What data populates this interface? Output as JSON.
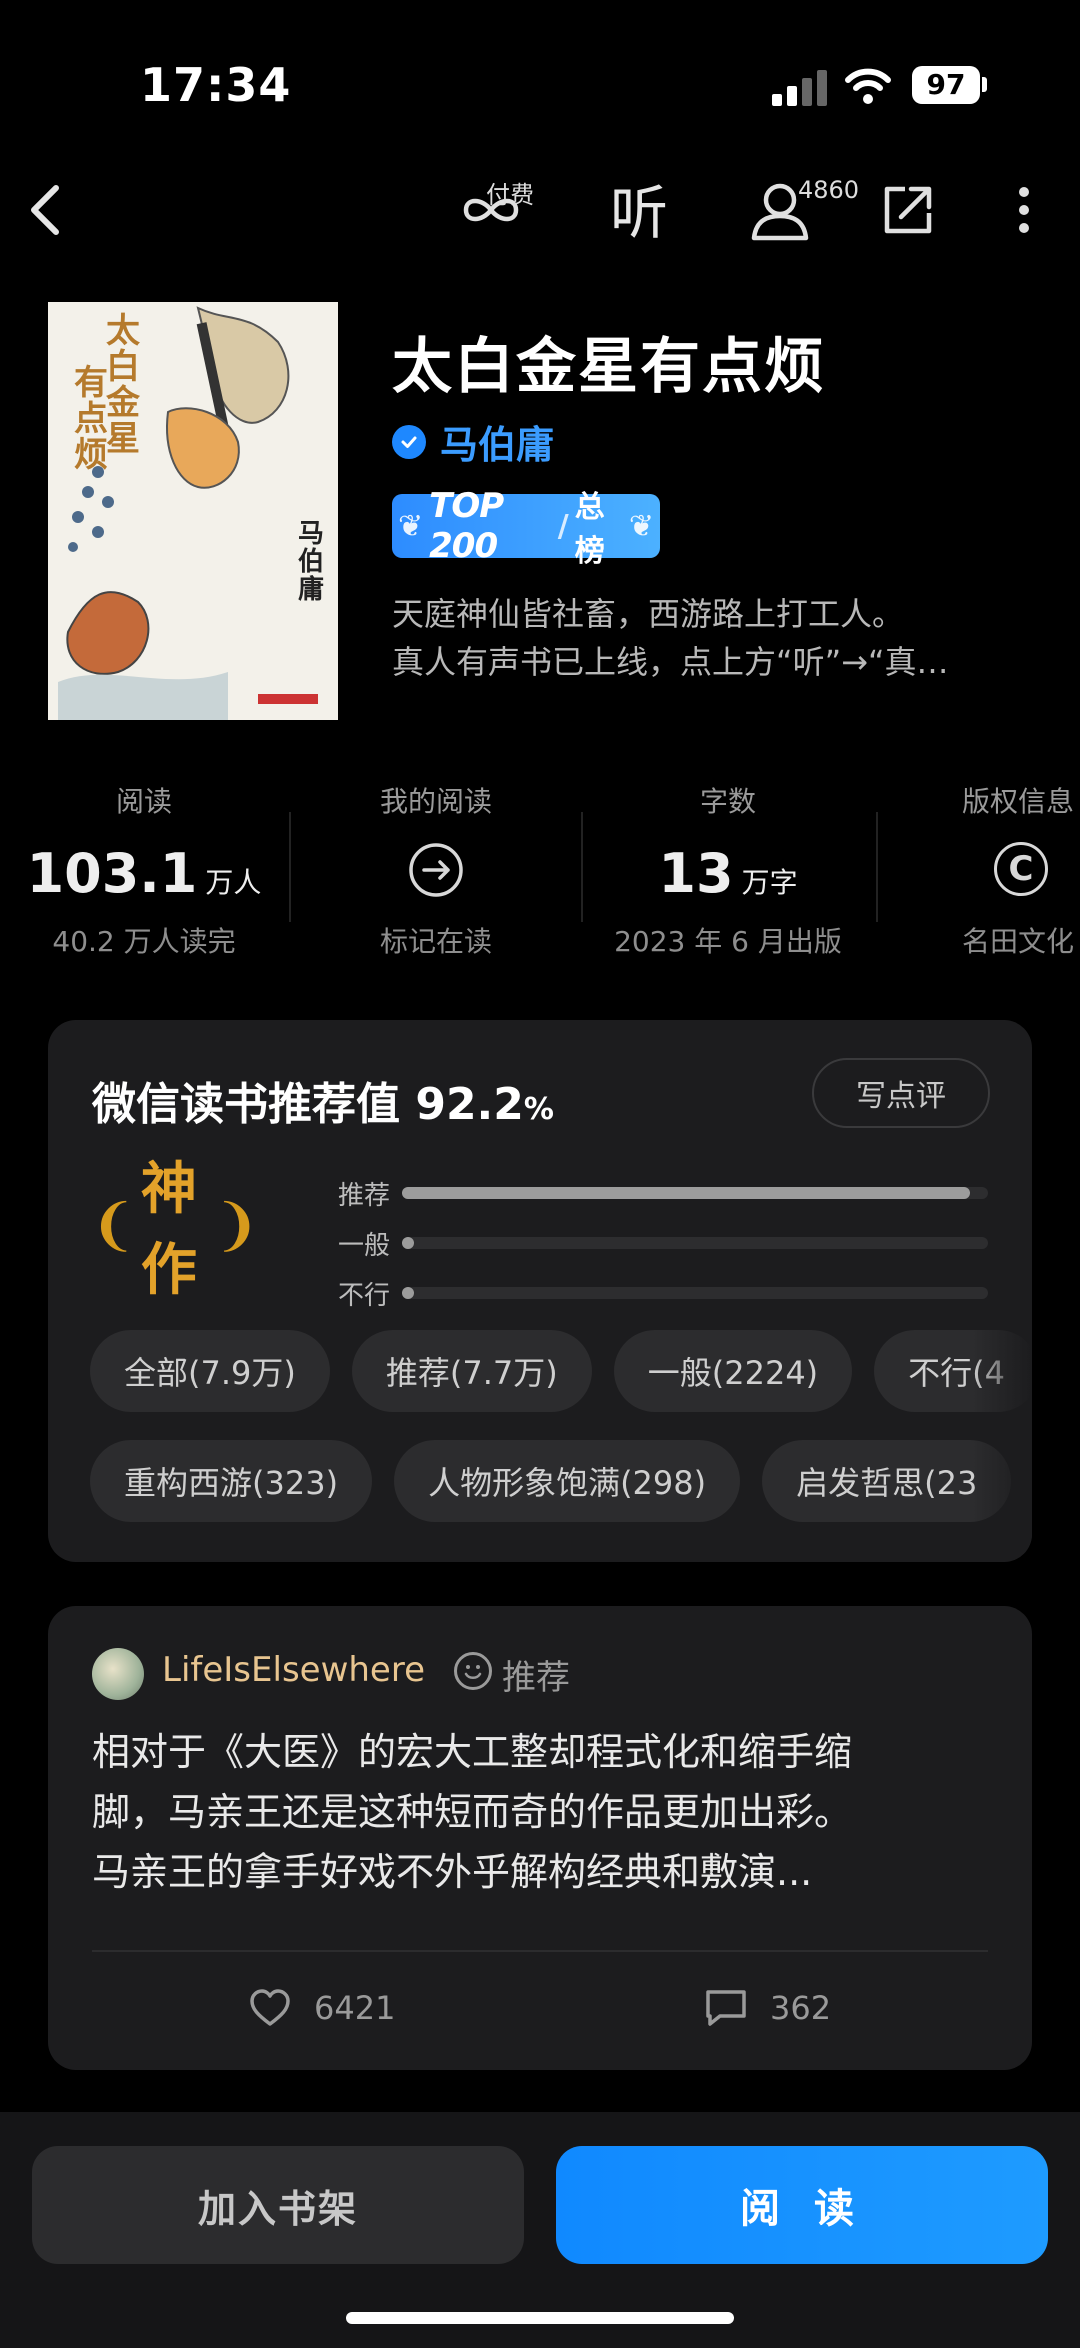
{
  "status": {
    "time": "17:34",
    "battery": "97"
  },
  "nav": {
    "pay_label": "付费",
    "listen_label": "听",
    "user_count": "4860"
  },
  "book": {
    "title": "太白金星有点烦",
    "author": "马伯庸",
    "rank_main": "TOP 200",
    "rank_sub": "总榜",
    "intro_line1": "天庭神仙皆社畜，西游路上打工人。",
    "intro_line2": "真人有声书已上线，点上方“听”→“真…",
    "cover": {
      "title": "太白金星有点烦",
      "author": "马伯庸"
    }
  },
  "stats": [
    {
      "label": "阅读",
      "value": "103.1",
      "unit": "万人",
      "sub": "40.2 万人读完"
    },
    {
      "label": "我的阅读",
      "icon": "arrow-circle-icon",
      "sub": "标记在读"
    },
    {
      "label": "字数",
      "value": "13",
      "unit": "万字",
      "sub": "2023 年 6 月出版"
    },
    {
      "label": "版权信息",
      "icon": "copyright-icon",
      "sub": "名田文化"
    }
  ],
  "recommend": {
    "title": "微信读书推荐值",
    "score": "92.2",
    "percent_sign": "%",
    "write_label": "写点评",
    "grade": "神作",
    "bars": [
      {
        "label": "推荐",
        "fraction": 0.97
      },
      {
        "label": "一般",
        "fraction": 0.02
      },
      {
        "label": "不行",
        "fraction": 0.006
      }
    ],
    "filters": [
      "全部(7.9万)",
      "推荐(7.7万)",
      "一般(2224)",
      "不行(4"
    ],
    "tags": [
      "重构西游(323)",
      "人物形象饱满(298)",
      "启发哲思(23"
    ]
  },
  "review": {
    "user": "LifeIsElsewhere",
    "verdict": "推荐",
    "lines": [
      "相对于《大医》的宏大工整却程式化和缩手缩",
      "脚，马亲王还是这种短而奇的作品更加出彩。",
      "马亲王的拿手好戏不外乎解构经典和敷演..."
    ],
    "likes": "6421",
    "comments": "362"
  },
  "bottom": {
    "shelf_label": "加入书架",
    "read_label": "阅 读"
  },
  "colors": {
    "accent": "#1E88FF",
    "grade_gold": "#E3A22A",
    "author_blue": "#3B9CFF"
  }
}
